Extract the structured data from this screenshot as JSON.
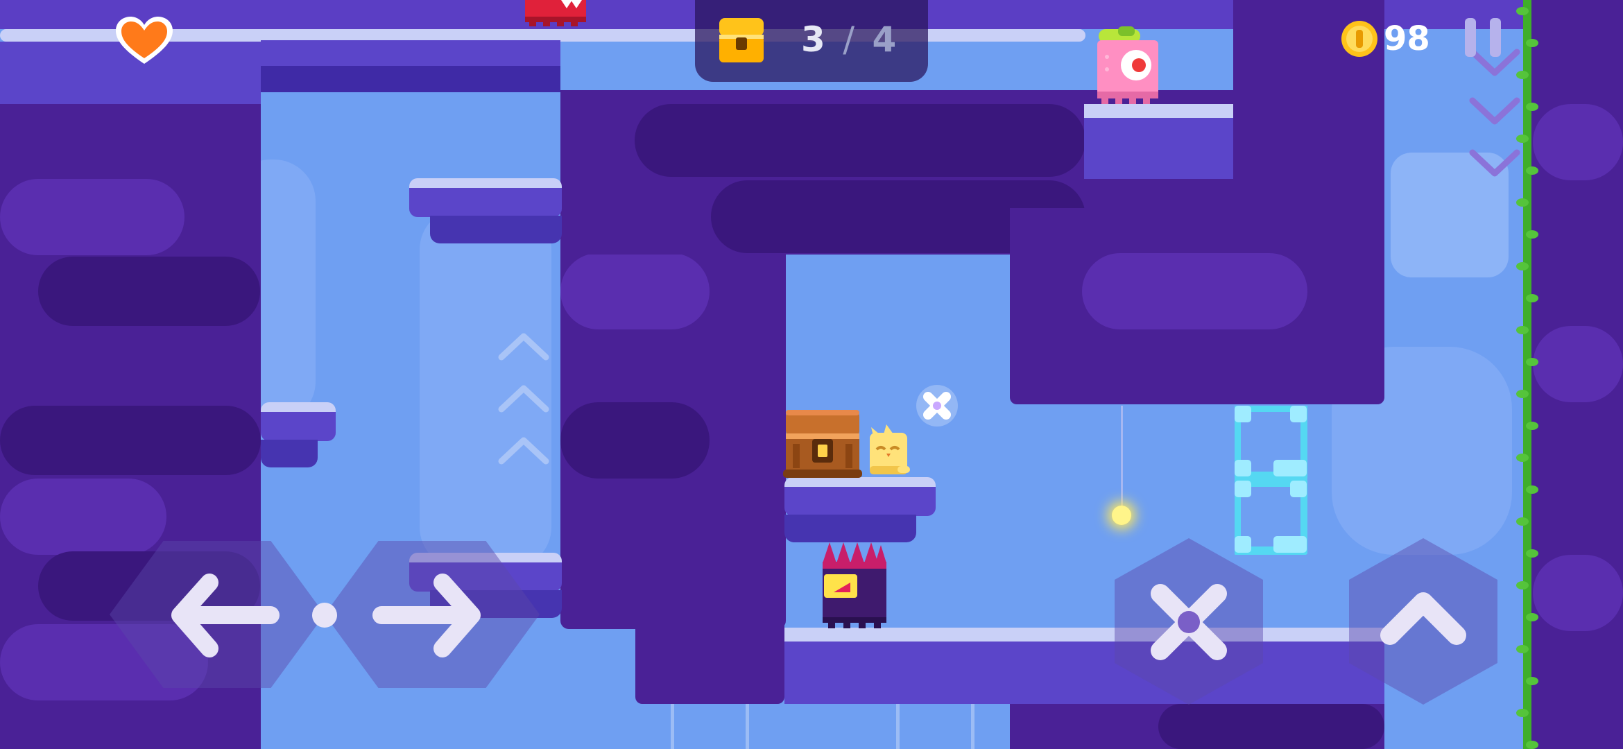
{
  "hud": {
    "lives_icon": "heart-icon",
    "chest_icon": "treasure-chest-icon",
    "chests_collected": "3",
    "chests_separator": "/",
    "chests_total": "4",
    "coin_icon": "gold-coin-icon",
    "coins": "98",
    "pause_icon": "pause-icon"
  },
  "controls": {
    "move_left": "arrow-left-icon",
    "move_right": "arrow-right-icon",
    "action": "x-action-icon",
    "jump": "chevron-up-icon"
  },
  "entities": {
    "player": "yellow-cat-player",
    "chest": "wooden-treasure-chest",
    "enemy_spiky": "purple-spiky-block-enemy",
    "enemy_pink": "pink-one-eyed-block-enemy",
    "enemy_red": "red-toothy-block-enemy",
    "sparkle": "glowing-star-pickup",
    "lamp": "hanging-lamp",
    "toggle_block": "cyan-toggle-blocks",
    "vine": "green-climbing-vine"
  },
  "colors": {
    "sky": "#6f9ff2",
    "wall": "#4a2196",
    "ledge_top": "#c9d0f7",
    "heart": "#ff7a1a",
    "coin": "#ffc31a",
    "vine": "#3fae2a"
  }
}
